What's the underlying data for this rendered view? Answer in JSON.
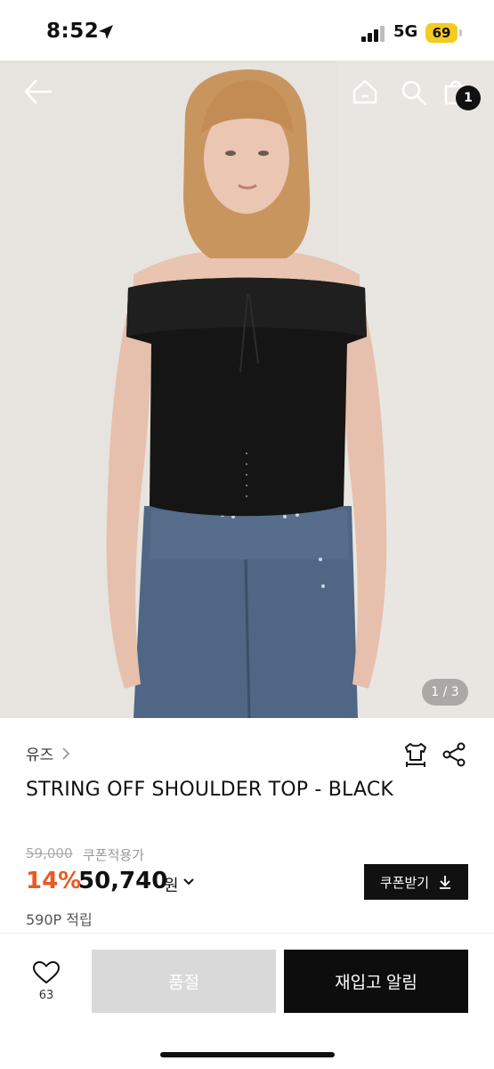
{
  "status_bar": {
    "time": "8:52",
    "network": "5G",
    "battery": "69"
  },
  "header": {
    "cart_count": "1"
  },
  "gallery": {
    "counter": "1 / 3"
  },
  "product": {
    "brand": "유즈",
    "title": "STRING OFF SHOULDER TOP - BLACK",
    "original_price": "59,000",
    "coupon_note": "쿠폰적용가",
    "discount": "14%",
    "price": "50,740",
    "currency": "원",
    "coupon_button": "쿠폰받기",
    "points": "590P 적립"
  },
  "bottom_bar": {
    "like_count": "63",
    "soldout_label": "품절",
    "restock_label": "재입고 알림"
  },
  "colors": {
    "accent_discount": "#ea5a23",
    "primary_dark": "#0d0d0d",
    "disabled": "#d9d9d9",
    "battery": "#f5cb1f"
  }
}
